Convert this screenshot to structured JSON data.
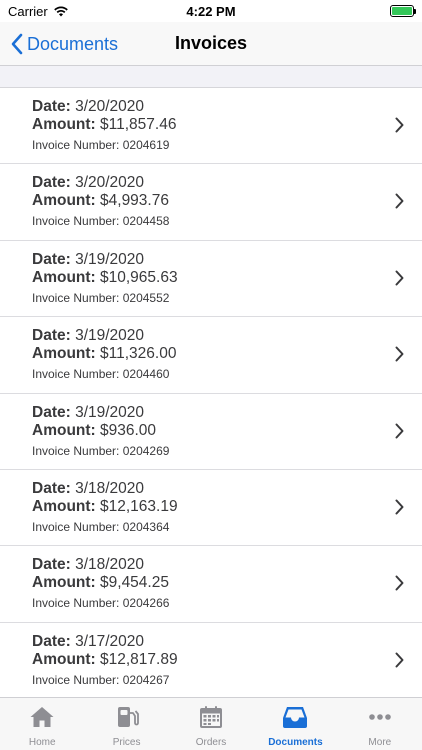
{
  "status_bar": {
    "carrier": "Carrier",
    "time": "4:22 PM",
    "battery_color": "#34c759"
  },
  "nav": {
    "back_label": "Documents",
    "title": "Invoices",
    "accent": "#1a6fd6"
  },
  "labels": {
    "date": "Date:",
    "amount": "Amount:",
    "invoice_number": "Invoice Number:"
  },
  "invoices": [
    {
      "date": "3/20/2020",
      "amount": "$11,857.46",
      "number": "0204619"
    },
    {
      "date": "3/20/2020",
      "amount": "$4,993.76",
      "number": "0204458"
    },
    {
      "date": "3/19/2020",
      "amount": "$10,965.63",
      "number": "0204552"
    },
    {
      "date": "3/19/2020",
      "amount": "$11,326.00",
      "number": "0204460"
    },
    {
      "date": "3/19/2020",
      "amount": "$936.00",
      "number": "0204269"
    },
    {
      "date": "3/18/2020",
      "amount": "$12,163.19",
      "number": "0204364"
    },
    {
      "date": "3/18/2020",
      "amount": "$9,454.25",
      "number": "0204266"
    },
    {
      "date": "3/17/2020",
      "amount": "$12,817.89",
      "number": "0204267"
    }
  ],
  "tabs": [
    {
      "label": "Home",
      "icon": "home-icon",
      "active": false
    },
    {
      "label": "Prices",
      "icon": "fuel-pump-icon",
      "active": false
    },
    {
      "label": "Orders",
      "icon": "calendar-icon",
      "active": false
    },
    {
      "label": "Documents",
      "icon": "inbox-tray-icon",
      "active": true
    },
    {
      "label": "More",
      "icon": "ellipsis-icon",
      "active": false
    }
  ]
}
